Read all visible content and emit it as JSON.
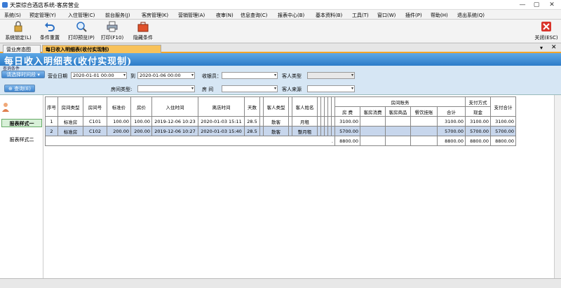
{
  "window": {
    "title": "天崇综合酒店系统-客房营业",
    "min": "—",
    "max": "▢",
    "close": "✕"
  },
  "menus": [
    "系统(S)",
    "预定管理(Y)",
    "入住管理(C)",
    "前台服务(J)",
    "客房管理(K)",
    "营销管理(A)",
    "夜审(N)",
    "信息查询(C)",
    "报表中心(B)",
    "基本资料(B)",
    "工具(T)",
    "窗口(W)",
    "插件(P)",
    "帮助(H)",
    "退出系统(Q)"
  ],
  "toolbar": {
    "lock": "系统锁定(L)",
    "reset": "条件重置",
    "preview": "打印预览(P)",
    "print": "打印(F10)",
    "hide": "隐藏条件",
    "close": "关闭(ESC)"
  },
  "tabs": {
    "tab1": "营业房态图",
    "tab2": "每日收入明细表(收付实现制)",
    "menu": "▾",
    "close": "✕"
  },
  "report_title": "每日收入明细表(收付实现制)",
  "query": {
    "group_label": "查询条件",
    "quick_select": "请选择时间段",
    "search_btn": "查询(E)",
    "date_label": "营业日期",
    "date_from": "2020-01-01 00:00",
    "to_label": "到",
    "date_to": "2020-01-06 00:00",
    "cashier_label": "收银员：",
    "cashier_value": "",
    "guest_type_label": "客人类型",
    "room_type_label": "房间类型:",
    "room_label": "房  间",
    "guest_source_label": "客人来源"
  },
  "side": {
    "style1": "报表样式一",
    "style2": "报表样式二"
  },
  "table": {
    "headers": {
      "seq": "序号",
      "room_type": "房间类型",
      "room_no": "房间号",
      "std_price": "标准价",
      "price": "房价",
      "checkin": "入住时间",
      "checkout": "离店时间",
      "days": "天数",
      "guest_type": "客人类型",
      "guest_name": "客人姓名",
      "room_account": "房间账务",
      "room_fee": "房 费",
      "room_consume": "客房消费",
      "room_goods": "客房商品",
      "meal": "餐饮挂账",
      "subtotal": "合计",
      "pay_method": "支付方式",
      "cash": "现金",
      "pay_total": "支付合计"
    },
    "rows": [
      {
        "seq": "1",
        "room_type": "标准房",
        "room_no": "C101",
        "std_price": "100.00",
        "price": "100.00",
        "checkin": "2019-12-06 10:23",
        "checkout": "2020-01-03 15:11",
        "days": "28.5",
        "guest_type": "散客",
        "guest_name": "月租",
        "room_fee": "3100.00",
        "subtotal": "3100.00",
        "cash": "3100.00",
        "pay_total": "3100.00"
      },
      {
        "seq": "2",
        "room_type": "标准房",
        "room_no": "C102",
        "std_price": "200.00",
        "price": "200.00",
        "checkin": "2019-12-06 10:27",
        "checkout": "2020-01-03 15:40",
        "days": "28.5",
        "guest_type": "散客",
        "guest_name": "整月租",
        "room_fee": "5700.00",
        "subtotal": "5700.00",
        "cash": "5700.00",
        "pay_total": "5700.00"
      }
    ],
    "totals": {
      "room_fee": "8800.00",
      "subtotal": "8800.00",
      "cash": "8800.00",
      "pay_total": "8800.00",
      "dot": "."
    }
  }
}
